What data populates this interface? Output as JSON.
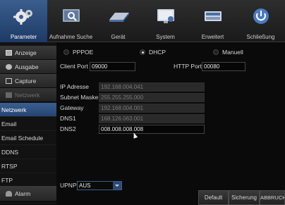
{
  "toolbar": {
    "items": [
      {
        "label": "Parameter",
        "icon": "gears-icon",
        "active": true
      },
      {
        "label": "Aufnahme Suche",
        "icon": "search-monitor-icon",
        "active": false
      },
      {
        "label": "Gerät",
        "icon": "hard-drive-icon",
        "active": false
      },
      {
        "label": "System",
        "icon": "system-monitor-icon",
        "active": false
      },
      {
        "label": "Erweitert",
        "icon": "advanced-icon",
        "active": false
      },
      {
        "label": "Schließung",
        "icon": "power-icon",
        "active": false
      }
    ]
  },
  "sidebar": {
    "categories": [
      {
        "label": "Anzeige",
        "icon": "monitor-icon"
      },
      {
        "label": "Ausgabe",
        "icon": "gear-icon"
      },
      {
        "label": "Capture",
        "icon": "capture-icon"
      },
      {
        "label": "Netzwerk",
        "icon": "network-icon"
      }
    ],
    "subitems": [
      "Netzwerk",
      "Email",
      "Email Schedule",
      "DDNS",
      "RTSP",
      "FTP"
    ],
    "bottom": {
      "label": "Alarm",
      "icon": "alarm-icon"
    }
  },
  "network": {
    "modes": [
      "PPPOE",
      "DHCP",
      "Manuell"
    ],
    "selected_mode": "DHCP",
    "client_port_label": "Client Port",
    "client_port": "09000",
    "http_port_label": "HTTP Port",
    "http_port": "00080",
    "ip_label": "IP Adresse",
    "ip": "192.168.004.041",
    "subnet_label": "Subnet Maske",
    "subnet": "255.255.255.000",
    "gateway_label": "Gateway",
    "gateway": "192.168.004.001",
    "dns1_label": "DNS1",
    "dns1": "168.126.063.001",
    "dns2_label": "DNS2",
    "dns2": "008.008.008.008",
    "upnp_label": "UPNP",
    "upnp_value": "AUS"
  },
  "buttons": {
    "default": "Default",
    "save": "Sicherung",
    "cancel": "ABBRUCH"
  },
  "colors": {
    "active_blue": "#2f5288"
  }
}
